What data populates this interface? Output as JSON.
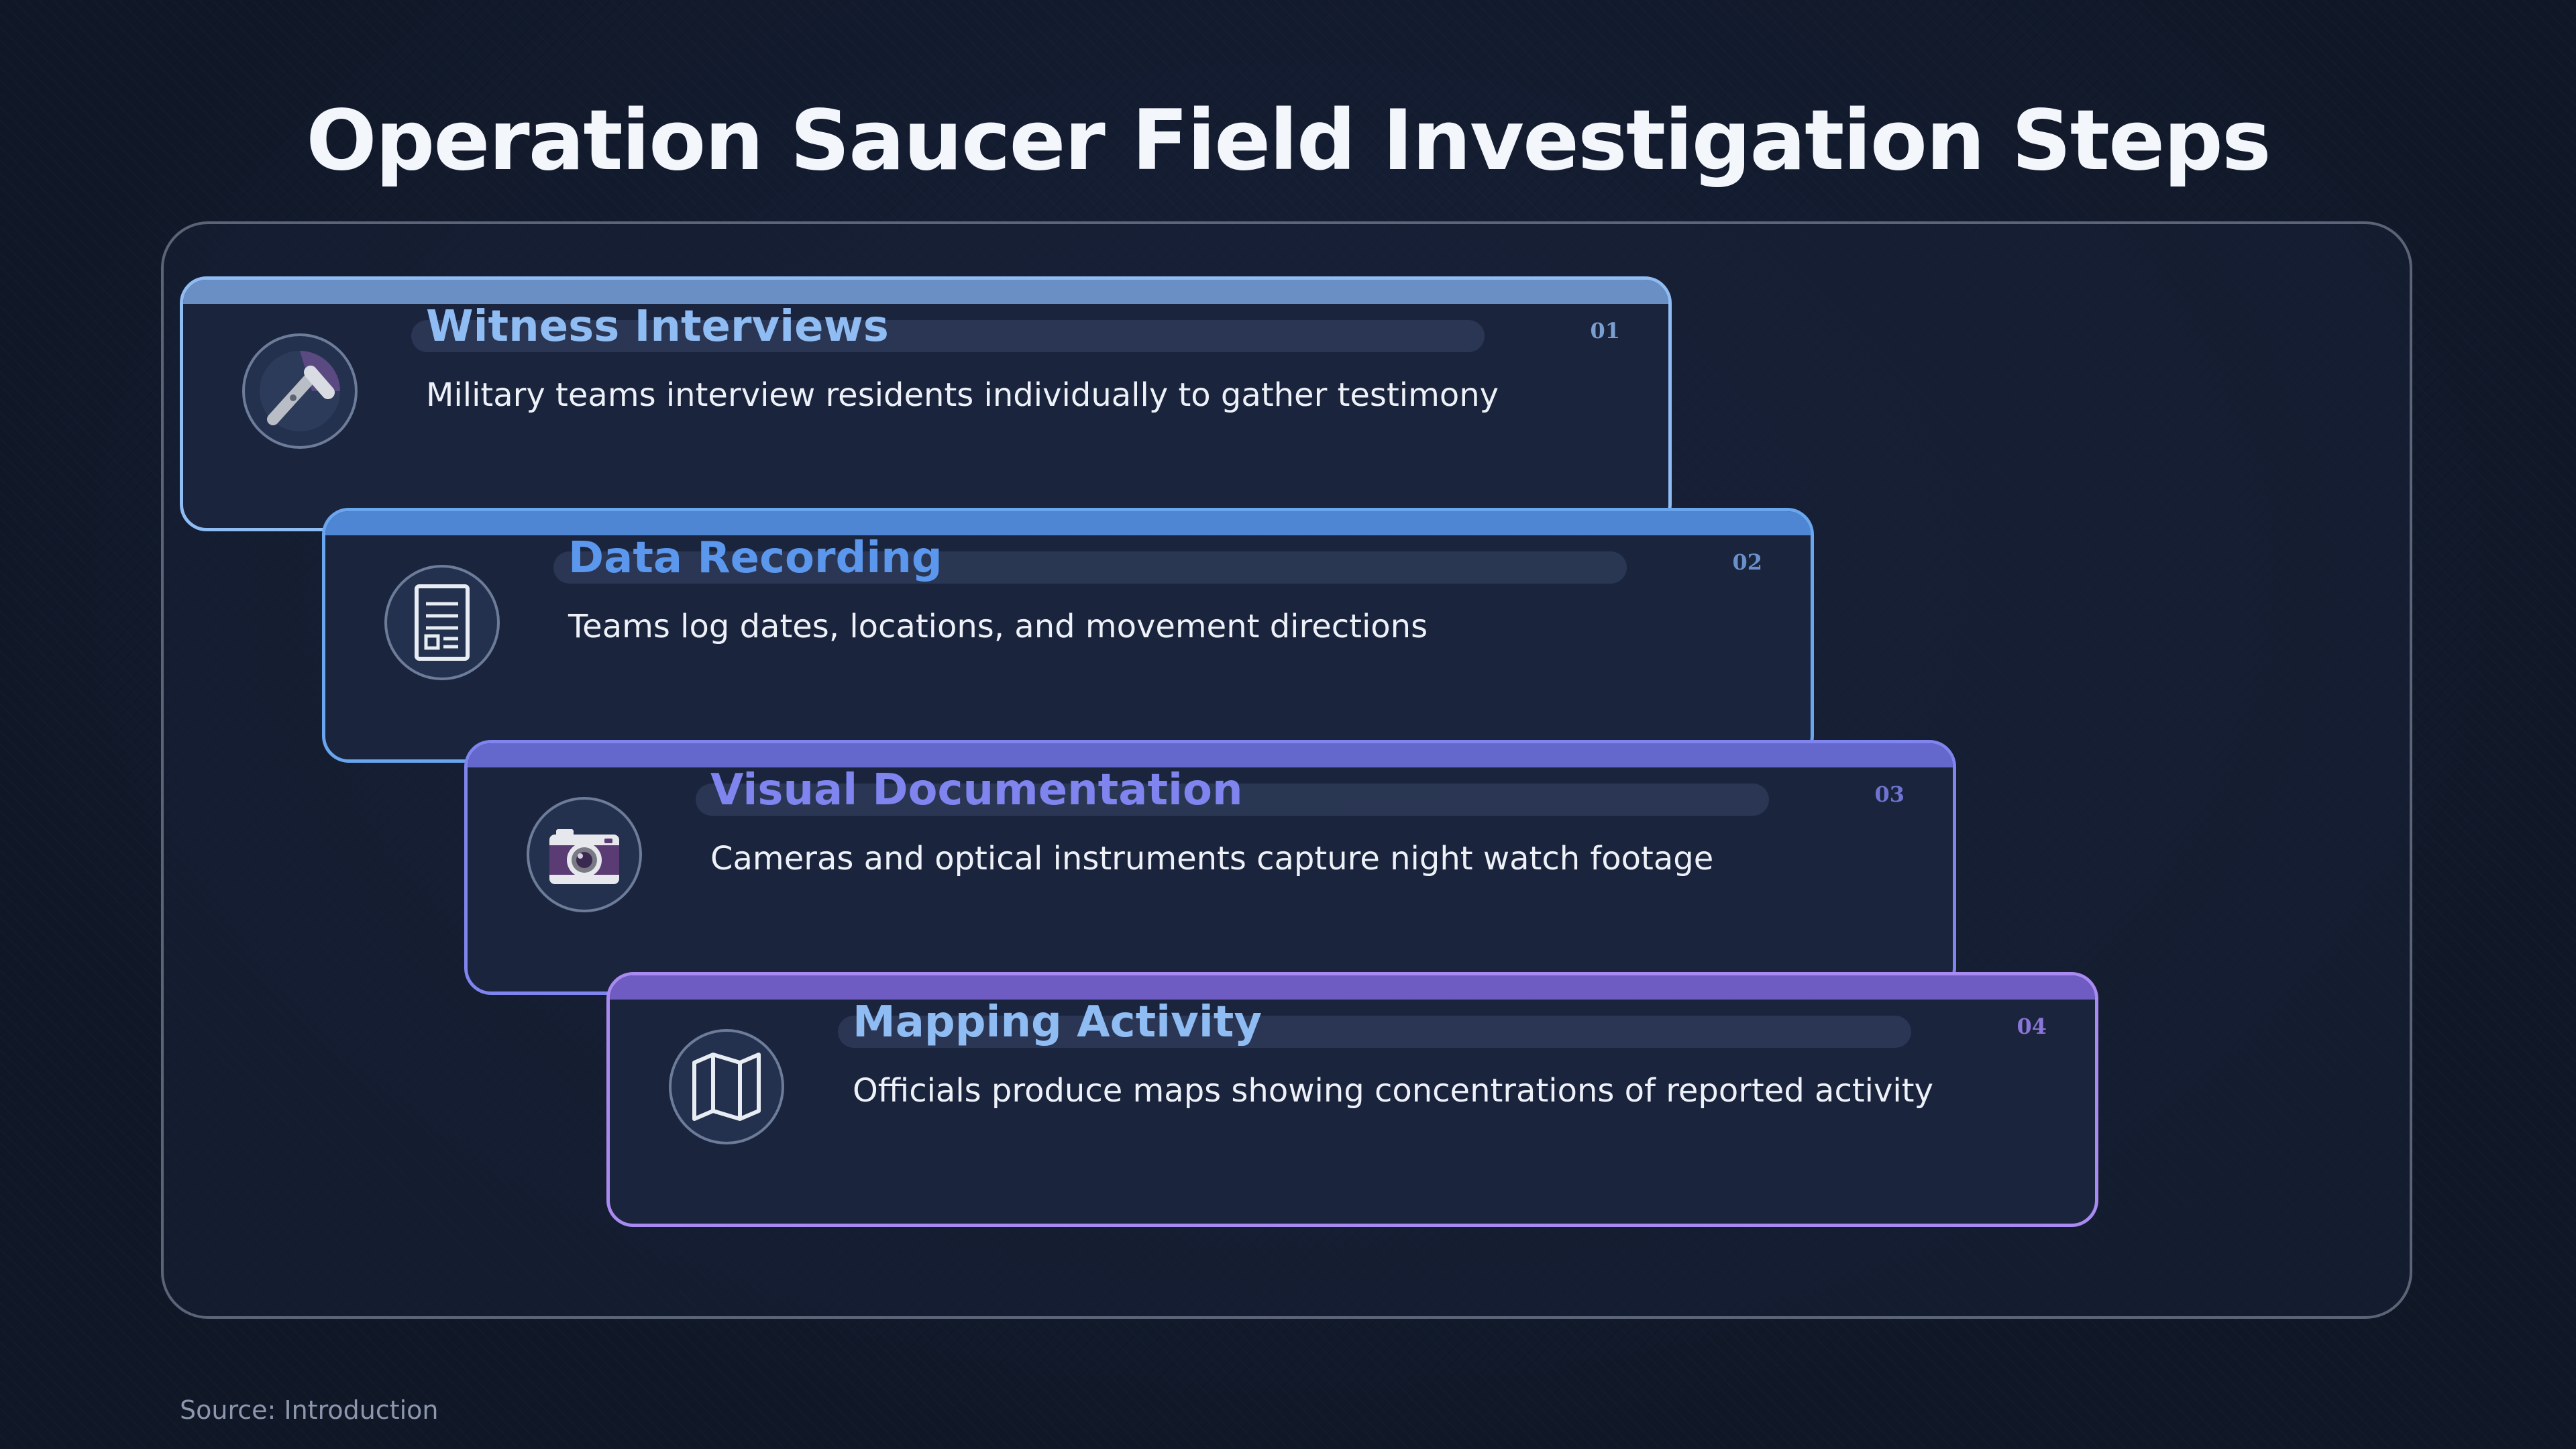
{
  "title": "Operation Saucer Field Investigation Steps",
  "steps": [
    {
      "title": "Witness Interviews",
      "description": "Military teams interview residents individually to gather testimony",
      "number": "01",
      "icon": "microphone-icon",
      "accent": "#8fbcf3"
    },
    {
      "title": "Data Recording",
      "description": "Teams log dates, locations, and movement directions",
      "number": "02",
      "icon": "document-icon",
      "accent": "#5b97ec"
    },
    {
      "title": "Visual Documentation",
      "description": "Cameras and optical instruments capture night watch footage",
      "number": "03",
      "icon": "camera-icon",
      "accent": "#7f84ee"
    },
    {
      "title": "Mapping Activity",
      "description": "Officials produce maps showing concentrations of reported activity",
      "number": "04",
      "icon": "map-icon",
      "accent": "#a98af0"
    }
  ],
  "source": "Source: Introduction"
}
